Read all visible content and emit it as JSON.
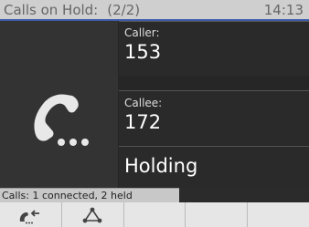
{
  "header": {
    "title": "Calls on Hold:",
    "count": "(2/2)",
    "time": "14:13"
  },
  "call": {
    "caller_label": "Caller:",
    "caller_value": "153",
    "callee_label": "Callee:",
    "callee_value": "172",
    "state": "Holding"
  },
  "status": {
    "text": "Calls: 1 connected, 2 held"
  },
  "softkeys": [
    {
      "icon": "resume-call-icon"
    },
    {
      "icon": "conference-icon"
    },
    {
      "icon": ""
    },
    {
      "icon": ""
    },
    {
      "icon": ""
    }
  ]
}
